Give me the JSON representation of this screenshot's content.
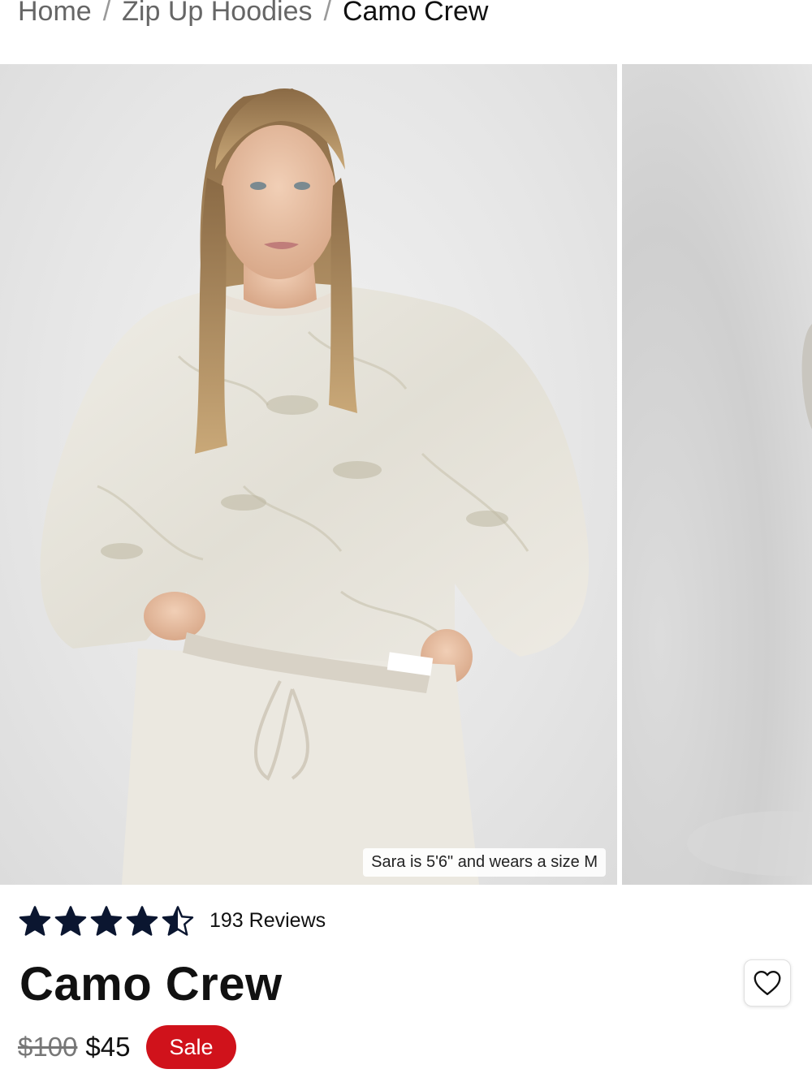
{
  "breadcrumb": {
    "home": "Home",
    "category": "Zip Up Hoodies",
    "current": "Camo Crew",
    "separator": "/"
  },
  "gallery": {
    "caption": "Sara is 5'6\" and wears a size M"
  },
  "rating": {
    "value": 4.5,
    "max": 5,
    "reviews_label": "193 Reviews"
  },
  "product": {
    "title": "Camo Crew",
    "original_price": "$100",
    "sale_price": "$45",
    "sale_badge": "Sale"
  },
  "colors": {
    "sale_red": "#d0121b",
    "star_navy": "#0b1630"
  },
  "icons": {
    "wishlist": "heart-outline-icon",
    "rating": "star-icon"
  }
}
